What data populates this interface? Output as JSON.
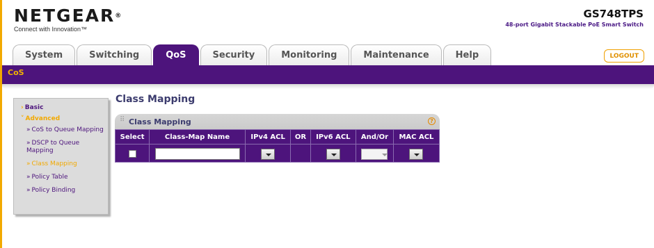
{
  "header": {
    "brand": "NETGEAR",
    "brand_mark": "®",
    "tagline": "Connect with Innovation™",
    "model": "GS748TPS",
    "model_desc": "48-port Gigabit Stackable PoE Smart Switch"
  },
  "tabs": [
    {
      "label": "System"
    },
    {
      "label": "Switching"
    },
    {
      "label": "QoS",
      "active": true
    },
    {
      "label": "Security"
    },
    {
      "label": "Monitoring"
    },
    {
      "label": "Maintenance"
    },
    {
      "label": "Help"
    }
  ],
  "logout_label": "LOGOUT",
  "subnav": {
    "label": "CoS"
  },
  "sidebar": {
    "basic": "Basic",
    "advanced": "Advanced",
    "items": [
      {
        "label": "CoS to Queue Mapping"
      },
      {
        "label": "DSCP to Queue Mapping"
      },
      {
        "label": "Class Mapping",
        "current": true
      },
      {
        "label": "Policy Table"
      },
      {
        "label": "Policy Binding"
      }
    ]
  },
  "page": {
    "title": "Class Mapping",
    "panel_title": "Class Mapping",
    "help_icon": "?"
  },
  "table": {
    "headers": [
      "Select",
      "Class-Map Name",
      "IPv4 ACL",
      "OR",
      "IPv6 ACL",
      "And/Or",
      "MAC ACL"
    ],
    "row": {
      "select_checked": false,
      "class_map_name": "",
      "ipv4_acl": "",
      "ipv6_acl": "",
      "and_or": "",
      "mac_acl": ""
    }
  },
  "colors": {
    "purple": "#4d147c",
    "accent": "#f2a900"
  }
}
